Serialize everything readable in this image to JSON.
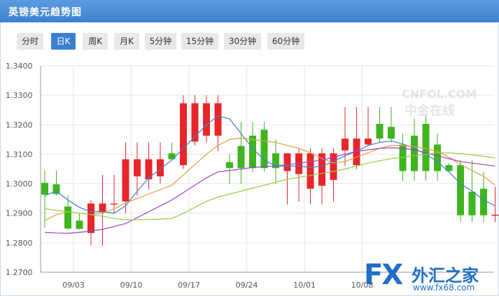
{
  "title": "英镑美元趋势图",
  "tabs": [
    {
      "label": "分时",
      "active": false
    },
    {
      "label": "日K",
      "active": true
    },
    {
      "label": "周K",
      "active": false
    },
    {
      "label": "月K",
      "active": false
    },
    {
      "label": "5分钟",
      "active": false
    },
    {
      "label": "15分钟",
      "active": false
    },
    {
      "label": "30分钟",
      "active": false
    },
    {
      "label": "60分钟",
      "active": false
    }
  ],
  "watermark": {
    "brand": "CNFOL.COM",
    "cn": "中金在线"
  },
  "logo": {
    "mark": "FX",
    "name": "外汇之家",
    "url": "www.fx68.com"
  },
  "colors": {
    "up": "#e8262a",
    "down": "#3eb51e",
    "ma_blue": "#3f7fd6",
    "ma_orange": "#e0a040",
    "ma_purple": "#a040d0",
    "ma_green": "#90d040",
    "grid": "#e6e6e6"
  },
  "chart_data": {
    "type": "candlestick",
    "ylim": [
      1.27,
      1.34
    ],
    "yticks": [
      "1.2700",
      "1.2800",
      "1.2900",
      "1.3000",
      "1.3100",
      "1.3200",
      "1.3300",
      "1.3400"
    ],
    "xlabels": [
      {
        "label": "09/03",
        "index": 2
      },
      {
        "label": "09/10",
        "index": 7
      },
      {
        "label": "09/17",
        "index": 12
      },
      {
        "label": "09/24",
        "index": 17
      },
      {
        "label": "10/01",
        "index": 22
      },
      {
        "label": "10/08",
        "index": 27
      }
    ],
    "candles": [
      {
        "o": 1.3003,
        "h": 1.3045,
        "l": 1.285,
        "c": 1.2963
      },
      {
        "o": 1.2998,
        "h": 1.3045,
        "l": 1.296,
        "c": 1.2965
      },
      {
        "o": 1.2923,
        "h": 1.296,
        "l": 1.2845,
        "c": 1.2848
      },
      {
        "o": 1.2875,
        "h": 1.29,
        "l": 1.2845,
        "c": 1.2847
      },
      {
        "o": 1.2833,
        "h": 1.2945,
        "l": 1.279,
        "c": 1.2933
      },
      {
        "o": 1.2903,
        "h": 1.303,
        "l": 1.279,
        "c": 1.2933
      },
      {
        "o": 1.2933,
        "h": 1.303,
        "l": 1.29,
        "c": 1.2933
      },
      {
        "o": 1.294,
        "h": 1.314,
        "l": 1.29,
        "c": 1.3083
      },
      {
        "o": 1.3025,
        "h": 1.314,
        "l": 1.296,
        "c": 1.3083
      },
      {
        "o": 1.3015,
        "h": 1.314,
        "l": 1.298,
        "c": 1.3083
      },
      {
        "o": 1.3025,
        "h": 1.314,
        "l": 1.3,
        "c": 1.3083
      },
      {
        "o": 1.3103,
        "h": 1.314,
        "l": 1.308,
        "c": 1.3083
      },
      {
        "o": 1.3063,
        "h": 1.33,
        "l": 1.305,
        "c": 1.3273
      },
      {
        "o": 1.3143,
        "h": 1.33,
        "l": 1.313,
        "c": 1.3273
      },
      {
        "o": 1.3163,
        "h": 1.33,
        "l": 1.314,
        "c": 1.3273
      },
      {
        "o": 1.3163,
        "h": 1.33,
        "l": 1.311,
        "c": 1.3273
      },
      {
        "o": 1.3073,
        "h": 1.31,
        "l": 1.3,
        "c": 1.3053
      },
      {
        "o": 1.3128,
        "h": 1.321,
        "l": 1.3,
        "c": 1.3053
      },
      {
        "o": 1.3163,
        "h": 1.321,
        "l": 1.304,
        "c": 1.3053
      },
      {
        "o": 1.3183,
        "h": 1.321,
        "l": 1.304,
        "c": 1.3053
      },
      {
        "o": 1.3103,
        "h": 1.315,
        "l": 1.3,
        "c": 1.3053
      },
      {
        "o": 1.3043,
        "h": 1.31,
        "l": 1.293,
        "c": 1.3103
      },
      {
        "o": 1.3033,
        "h": 1.312,
        "l": 1.294,
        "c": 1.3103
      },
      {
        "o": 1.2983,
        "h": 1.312,
        "l": 1.293,
        "c": 1.3103
      },
      {
        "o": 1.2993,
        "h": 1.312,
        "l": 1.293,
        "c": 1.3103
      },
      {
        "o": 1.3013,
        "h": 1.312,
        "l": 1.294,
        "c": 1.3103
      },
      {
        "o": 1.3113,
        "h": 1.326,
        "l": 1.306,
        "c": 1.3153
      },
      {
        "o": 1.3063,
        "h": 1.326,
        "l": 1.305,
        "c": 1.3153
      },
      {
        "o": 1.3133,
        "h": 1.326,
        "l": 1.313,
        "c": 1.3153
      },
      {
        "o": 1.3203,
        "h": 1.326,
        "l": 1.314,
        "c": 1.3153
      },
      {
        "o": 1.3193,
        "h": 1.326,
        "l": 1.314,
        "c": 1.3153
      },
      {
        "o": 1.3133,
        "h": 1.317,
        "l": 1.301,
        "c": 1.3043
      },
      {
        "o": 1.3163,
        "h": 1.322,
        "l": 1.301,
        "c": 1.3043
      },
      {
        "o": 1.3203,
        "h": 1.323,
        "l": 1.301,
        "c": 1.3043
      },
      {
        "o": 1.3133,
        "h": 1.317,
        "l": 1.301,
        "c": 1.3043
      },
      {
        "o": 1.3063,
        "h": 1.307,
        "l": 1.304,
        "c": 1.3043
      },
      {
        "o": 1.3063,
        "h": 1.308,
        "l": 1.287,
        "c": 1.2893
      },
      {
        "o": 1.2973,
        "h": 1.308,
        "l": 1.287,
        "c": 1.2893
      },
      {
        "o": 1.2983,
        "h": 1.304,
        "l": 1.287,
        "c": 1.2893
      },
      {
        "o": 1.2893,
        "h": 1.299,
        "l": 1.287,
        "c": 1.2895
      }
    ],
    "ma": [
      {
        "color": "#3f7fd6",
        "values": [
          1.296,
          1.2975,
          1.2945,
          1.292,
          1.2905,
          1.2905,
          1.29,
          1.2925,
          1.2975,
          1.302,
          1.305,
          1.308,
          1.312,
          1.316,
          1.32,
          1.323,
          1.322,
          1.317,
          1.312,
          1.308,
          1.306,
          1.306,
          1.306,
          1.3055,
          1.306,
          1.3075,
          1.3095,
          1.311,
          1.313,
          1.314,
          1.3145,
          1.3135,
          1.312,
          1.31,
          1.3075,
          1.304,
          1.3,
          1.2975,
          1.2945,
          1.2925
        ]
      },
      {
        "color": "#e0a040",
        "values": [
          1.2875,
          1.2895,
          1.2905,
          1.29,
          1.2895,
          1.29,
          1.2915,
          1.2935,
          1.295,
          1.2965,
          1.298,
          1.2995,
          1.303,
          1.3065,
          1.31,
          1.313,
          1.315,
          1.3155,
          1.315,
          1.3145,
          1.314,
          1.313,
          1.312,
          1.3105,
          1.3085,
          1.307,
          1.3075,
          1.309,
          1.3105,
          1.312,
          1.313,
          1.313,
          1.3125,
          1.312,
          1.311,
          1.309,
          1.3065,
          1.3045,
          1.3025,
          1.2995
        ]
      },
      {
        "color": "#a040d0",
        "values": [
          1.2835,
          1.2833,
          1.2832,
          1.2835,
          1.284,
          1.2845,
          1.2855,
          1.2865,
          1.2885,
          1.2905,
          1.2925,
          1.2945,
          1.297,
          1.2995,
          1.302,
          1.304,
          1.3045,
          1.305,
          1.3055,
          1.3058,
          1.306,
          1.3065,
          1.307,
          1.3075,
          1.308,
          1.309,
          1.31,
          1.311,
          1.3115,
          1.312,
          1.3122,
          1.312,
          1.3115,
          1.3105,
          1.3095,
          1.3085,
          1.3075,
          1.307,
          1.3065,
          1.306
        ]
      },
      {
        "color": "#90d040",
        "values": [
          1.2915,
          1.291,
          1.2905,
          1.29,
          1.2895,
          1.289,
          1.2882,
          1.2878,
          1.2878,
          1.2879,
          1.288,
          1.2882,
          1.29,
          1.292,
          1.294,
          1.2955,
          1.2965,
          1.2975,
          1.2985,
          1.2995,
          1.3005,
          1.3015,
          1.3022,
          1.3028,
          1.3035,
          1.3042,
          1.305,
          1.306,
          1.307,
          1.3078,
          1.3085,
          1.309,
          1.3095,
          1.31,
          1.3105,
          1.3105,
          1.3102,
          1.3098,
          1.3093,
          1.3088
        ]
      }
    ]
  }
}
